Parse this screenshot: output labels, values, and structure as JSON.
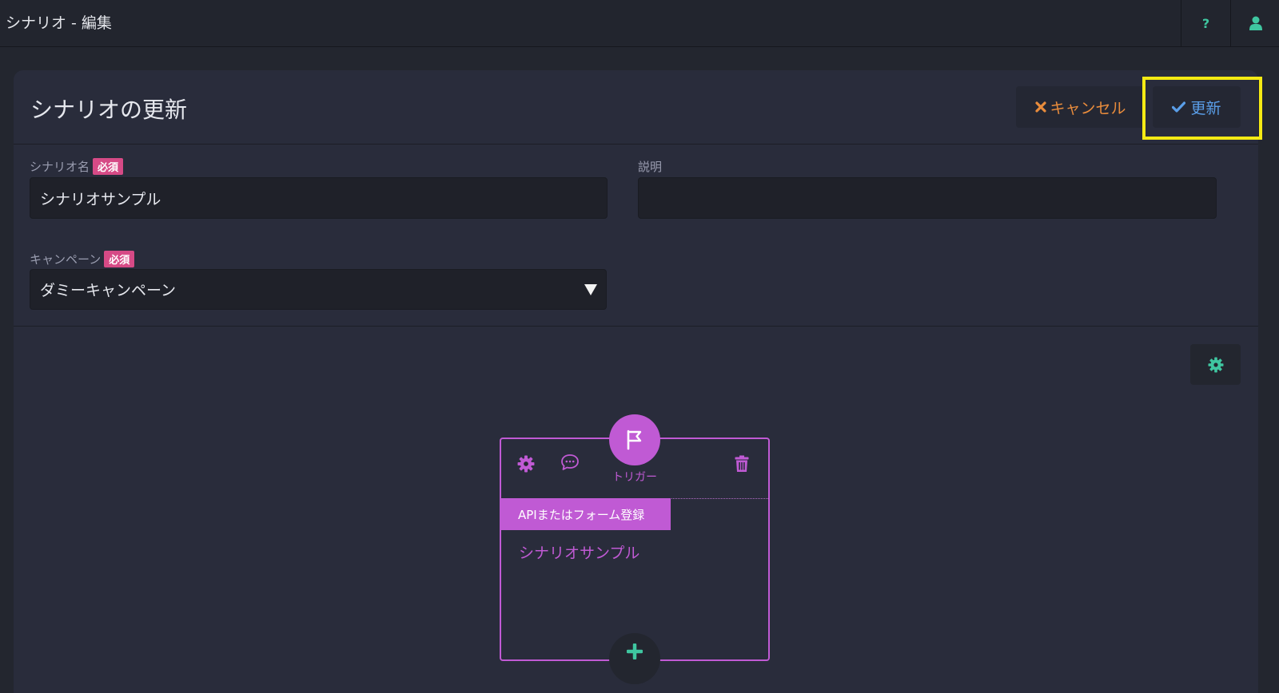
{
  "topbar": {
    "title": "シナリオ - 編集",
    "help_icon_text": "?"
  },
  "header": {
    "title": "シナリオの更新",
    "cancel_label": "キャンセル",
    "update_label": "更新"
  },
  "form": {
    "scenario_name_label": "シナリオ名",
    "required_badge": "必須",
    "scenario_name_value": "シナリオサンプル",
    "description_label": "説明",
    "description_value": "",
    "campaign_label": "キャンペーン",
    "campaign_value": "ダミーキャンペーン"
  },
  "node": {
    "label": "トリガー",
    "tag": "APIまたはフォーム登録",
    "name": "シナリオサンプル"
  },
  "colors": {
    "accent_teal": "#3fc6a0",
    "node_purple": "#c05ad4",
    "cancel_orange": "#e98c3c",
    "update_blue": "#5a9ee8",
    "required_pink": "#d64a86",
    "highlight_yellow": "#f5ea14"
  },
  "icons": [
    "help-icon",
    "user-icon",
    "close-icon",
    "check-icon",
    "gear-icon",
    "comment-icon",
    "trash-icon",
    "flag-icon",
    "plus-icon",
    "chevron-down-icon"
  ]
}
